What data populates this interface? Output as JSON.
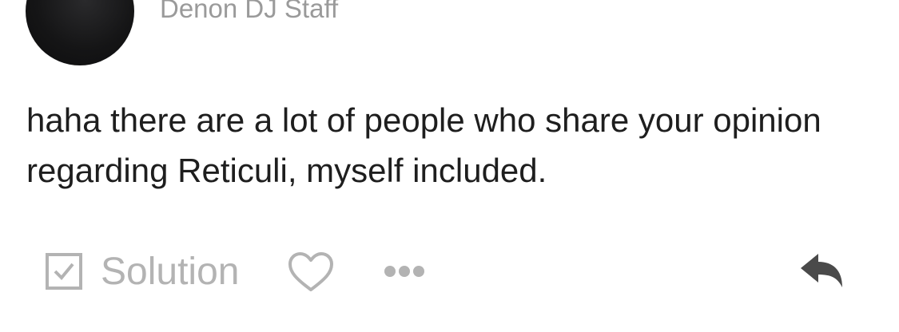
{
  "post": {
    "author_title": "Denon DJ Staff",
    "body": "haha there are a lot of people who share your opinion regarding Reticuli, myself included.",
    "avatar_icon": "user-avatar"
  },
  "actions": {
    "solution_label": "Solution",
    "solution_icon": "checkbox-check-icon",
    "like_icon": "heart-outline-icon",
    "more_icon": "ellipsis-icon",
    "reply_icon": "reply-arrow-icon"
  },
  "colors": {
    "body_text": "#1e1e1e",
    "muted_text": "#9a9a9a",
    "icon_light": "#b3b3b3",
    "icon_dark": "#4a4a4a"
  }
}
